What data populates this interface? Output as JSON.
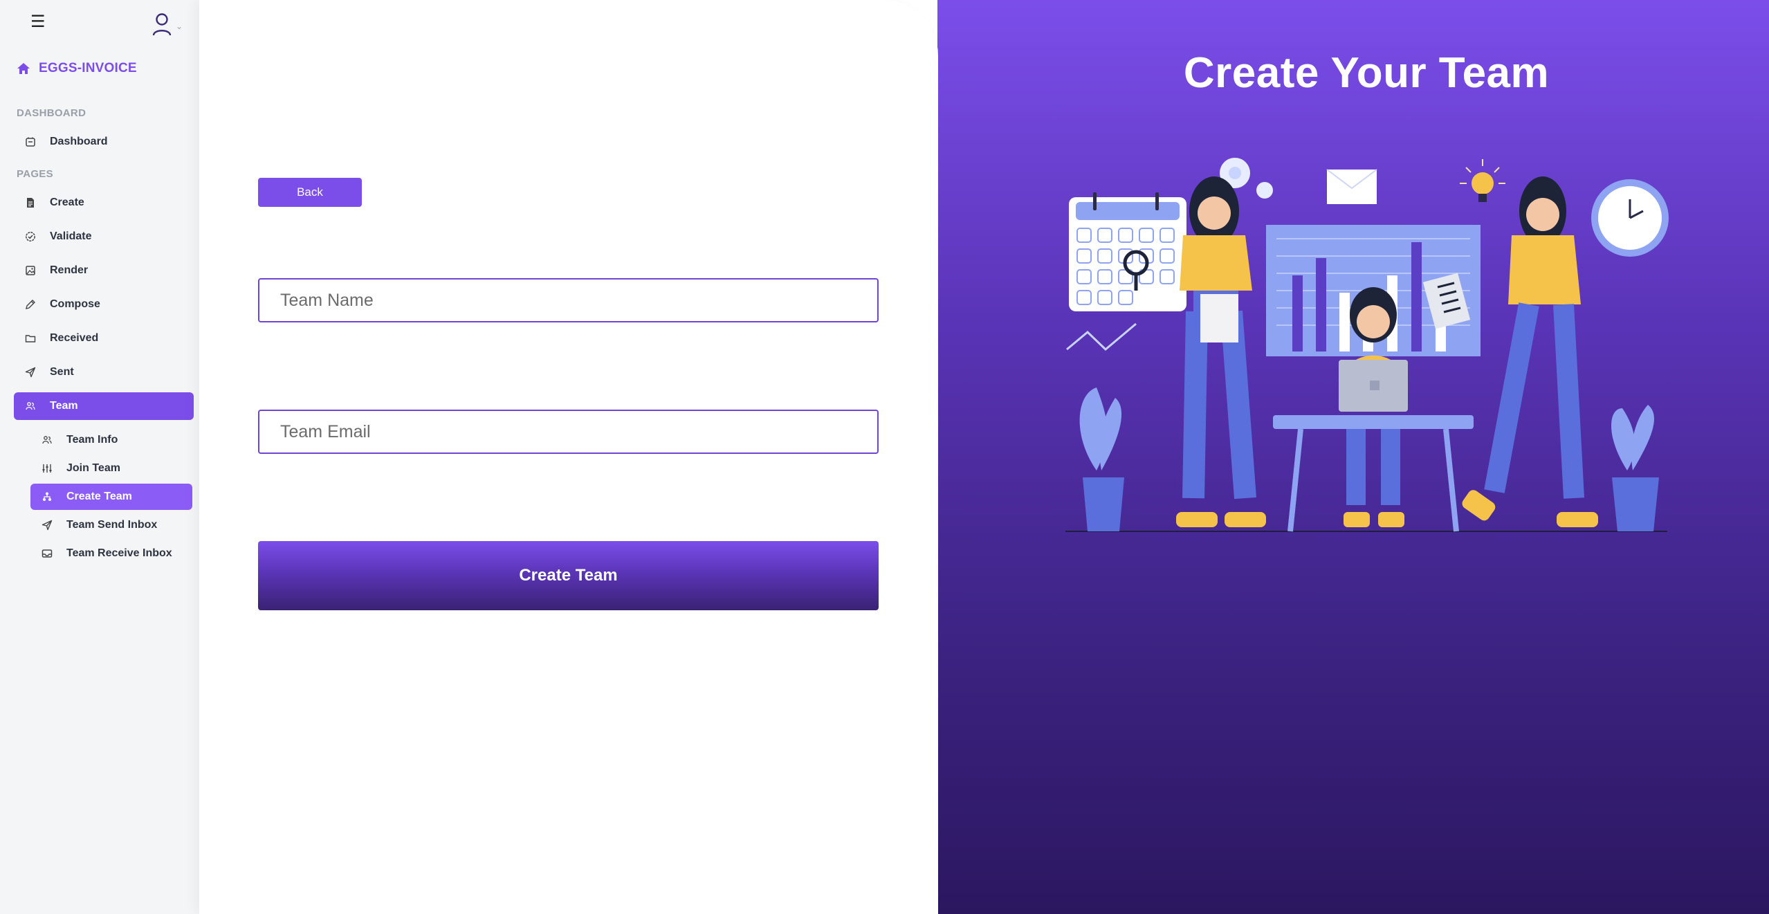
{
  "app": {
    "brand": "EGGS-INVOICE"
  },
  "sidebar": {
    "section_dashboard": "DASHBOARD",
    "section_pages": "PAGES",
    "items": {
      "dashboard": "Dashboard",
      "create": "Create",
      "validate": "Validate",
      "render": "Render",
      "compose": "Compose",
      "received": "Received",
      "sent": "Sent",
      "team": "Team"
    },
    "team_sub": {
      "team_info": "Team Info",
      "join_team": "Join Team",
      "create_team": "Create Team",
      "team_send_inbox": "Team Send Inbox",
      "team_receive_inbox": "Team Receive Inbox"
    },
    "active_item": "Team",
    "active_sub_item": "Create Team"
  },
  "form": {
    "back_label": "Back",
    "team_name_placeholder": "Team Name",
    "team_email_placeholder": "Team Email",
    "submit_label": "Create Team"
  },
  "panel": {
    "title": "Create Your Team"
  },
  "colors": {
    "accent": "#7b4eea",
    "panel_dark": "#2b1760",
    "illustration_shirt": "#f6c34a",
    "illustration_pants": "#5b6fdc"
  }
}
